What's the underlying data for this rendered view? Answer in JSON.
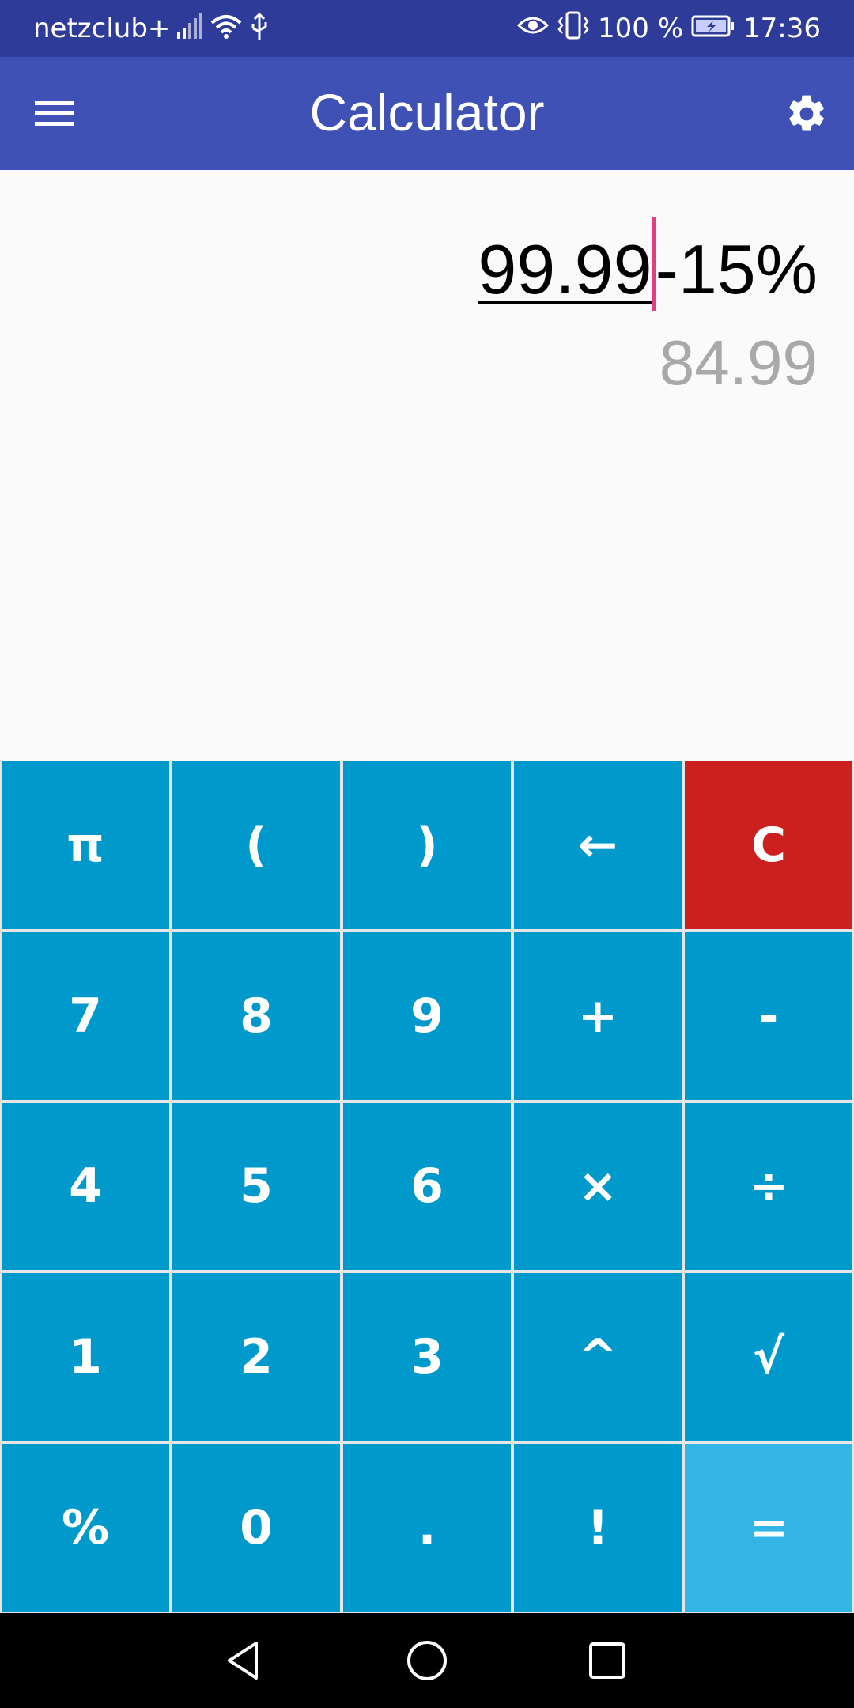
{
  "status_bar": {
    "carrier": "netzclub+",
    "battery_percent": "100 %",
    "time": "17:36",
    "icons": [
      "signal-icon",
      "wifi-icon",
      "usb-icon",
      "eye-icon",
      "vibrate-icon",
      "battery-charging-icon"
    ]
  },
  "app_bar": {
    "title": "Calculator",
    "menu_icon": "hamburger-menu-icon",
    "settings_icon": "gear-icon"
  },
  "display": {
    "expression_number": "99.99",
    "expression_rest": "-15%",
    "result": "84.99"
  },
  "keypad": {
    "keys": [
      [
        "π",
        "(",
        ")",
        "←",
        "C"
      ],
      [
        "7",
        "8",
        "9",
        "+",
        "-"
      ],
      [
        "4",
        "5",
        "6",
        "×",
        "÷"
      ],
      [
        "1",
        "2",
        "3",
        "^",
        "√"
      ],
      [
        "%",
        "0",
        ".",
        "!",
        "="
      ]
    ]
  },
  "colors": {
    "status_bar": "#2f3b99",
    "app_bar": "#3f51b5",
    "key": "#0099cc",
    "clear_key": "#cc2020",
    "equals_key": "#33b5e5",
    "cursor": "#e0407e",
    "result_text": "#a9a9a9"
  },
  "nav_bar": {
    "icons": [
      "back-icon",
      "home-icon",
      "recents-icon"
    ]
  }
}
